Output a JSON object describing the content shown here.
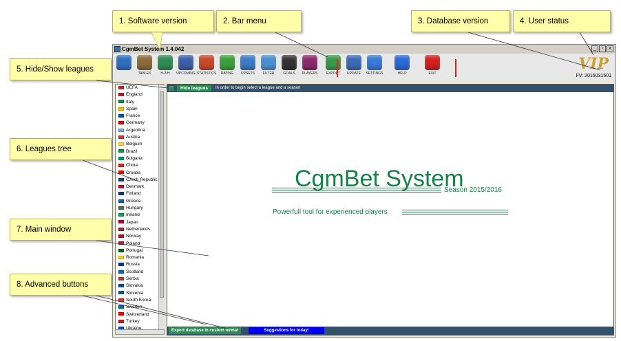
{
  "callouts": [
    {
      "label": "1. Software version"
    },
    {
      "label": "2. Bar menu"
    },
    {
      "label": "3. Database version"
    },
    {
      "label": "4. User status"
    },
    {
      "label": "5. Hide/Show leagues"
    },
    {
      "label": "6. Leagues tree"
    },
    {
      "label": "7. Main window"
    },
    {
      "label": "8. Advanced buttons"
    }
  ],
  "window": {
    "title": "CgmBet System  1.4.042",
    "controls": [
      "_",
      "▫",
      "x"
    ]
  },
  "toolbar": {
    "items": [
      {
        "label": "",
        "icon": "home-icon",
        "color": "#2f6fbf"
      },
      {
        "label": "TABLES",
        "icon": "tables-icon",
        "color": "#8a6b3a"
      },
      {
        "label": "H-2-H",
        "icon": "h2h-icon",
        "color": "#2e8b57"
      },
      {
        "label": "UPCOMING",
        "icon": "upcoming-icon",
        "color": "#3a5fa8"
      },
      {
        "label": "STATISTICS",
        "icon": "statistics-icon",
        "color": "#c8482a"
      },
      {
        "label": "RATING",
        "icon": "rating-icon",
        "color": "#3aa03a"
      },
      {
        "label": "UPSETS",
        "icon": "upsets-icon",
        "color": "#3a7ac8"
      },
      {
        "label": "FILTER",
        "icon": "filter-icon",
        "color": "#4a90d0"
      },
      {
        "label": "GOALS",
        "icon": "goals-icon",
        "color": "#333333"
      },
      {
        "label": "PLAYERS",
        "icon": "players-icon",
        "color": "#8a2a6a"
      },
      {
        "label": "EXPORT",
        "icon": "export-icon",
        "color": "#3a9a4a"
      },
      {
        "label": "UPDATE",
        "icon": "update-icon",
        "color": "#3a6ab8"
      },
      {
        "label": "SETTINGS",
        "icon": "settings-icon",
        "color": "#3a7ad8"
      },
      {
        "label": "HELP",
        "icon": "help-icon",
        "color": "#2a6ad8"
      },
      {
        "label": "EXIT",
        "icon": "exit-icon",
        "color": "#d22020"
      }
    ]
  },
  "status": {
    "vip": "VIP",
    "fv": "FV: 2016031501"
  },
  "leagues": [
    {
      "name": "UEFA",
      "color": "#cc2222"
    },
    {
      "name": "England",
      "color": "#c8102e"
    },
    {
      "name": "Italy",
      "color": "#009246"
    },
    {
      "name": "Spain",
      "color": "#f1bf00"
    },
    {
      "name": "France",
      "color": "#0055a4"
    },
    {
      "name": "Germany",
      "color": "#dd0000"
    },
    {
      "name": "Argentina",
      "color": "#74acdf"
    },
    {
      "name": "Austria",
      "color": "#ed2939"
    },
    {
      "name": "Belgium",
      "color": "#fdda24"
    },
    {
      "name": "Brazil",
      "color": "#009c3b"
    },
    {
      "name": "Bulgaria",
      "color": "#00966e"
    },
    {
      "name": "China",
      "color": "#de2910"
    },
    {
      "name": "Croatia",
      "color": "#ff0000"
    },
    {
      "name": "Czech Republic",
      "color": "#11457e"
    },
    {
      "name": "Denmark",
      "color": "#c60c30"
    },
    {
      "name": "Finland",
      "color": "#003580"
    },
    {
      "name": "Greece",
      "color": "#0d5eaf"
    },
    {
      "name": "Hungary",
      "color": "#477050"
    },
    {
      "name": "Ireland",
      "color": "#169b62"
    },
    {
      "name": "Japan",
      "color": "#bc002d"
    },
    {
      "name": "Netherlands",
      "color": "#ae1c28"
    },
    {
      "name": "Norway",
      "color": "#ba0c2f"
    },
    {
      "name": "Poland",
      "color": "#dc143c"
    },
    {
      "name": "Portugal",
      "color": "#006600"
    },
    {
      "name": "Romania",
      "color": "#fcd116"
    },
    {
      "name": "Russia",
      "color": "#0039a6"
    },
    {
      "name": "Scotland",
      "color": "#0065bd"
    },
    {
      "name": "Serbia",
      "color": "#c6363c"
    },
    {
      "name": "Slovakia",
      "color": "#0b4ea2"
    },
    {
      "name": "Slovenia",
      "color": "#005da4"
    },
    {
      "name": "South Korea",
      "color": "#cd2e3a"
    },
    {
      "name": "Sweden",
      "color": "#006aa7"
    },
    {
      "name": "Switzerland",
      "color": "#ff0000"
    },
    {
      "name": "Turkey",
      "color": "#e30a17"
    },
    {
      "name": "Ukraine",
      "color": "#0057b7"
    }
  ],
  "main": {
    "hide_label": "Hide leagues",
    "hide_icon": "−",
    "hint": "In order to begin select a league  and a season",
    "season": "Season 2015/2016",
    "app_name": "CgmBet System",
    "tagline": "Powerfull tool for experienced players",
    "export_label": "Export database in custom format",
    "suggest_label": "Suggestions for today!"
  },
  "colors": {
    "accent_green": "#16824a",
    "callout_bg": "#ffffaa",
    "bar_dark": "#34516b",
    "vip_gold": "#c9a233"
  }
}
